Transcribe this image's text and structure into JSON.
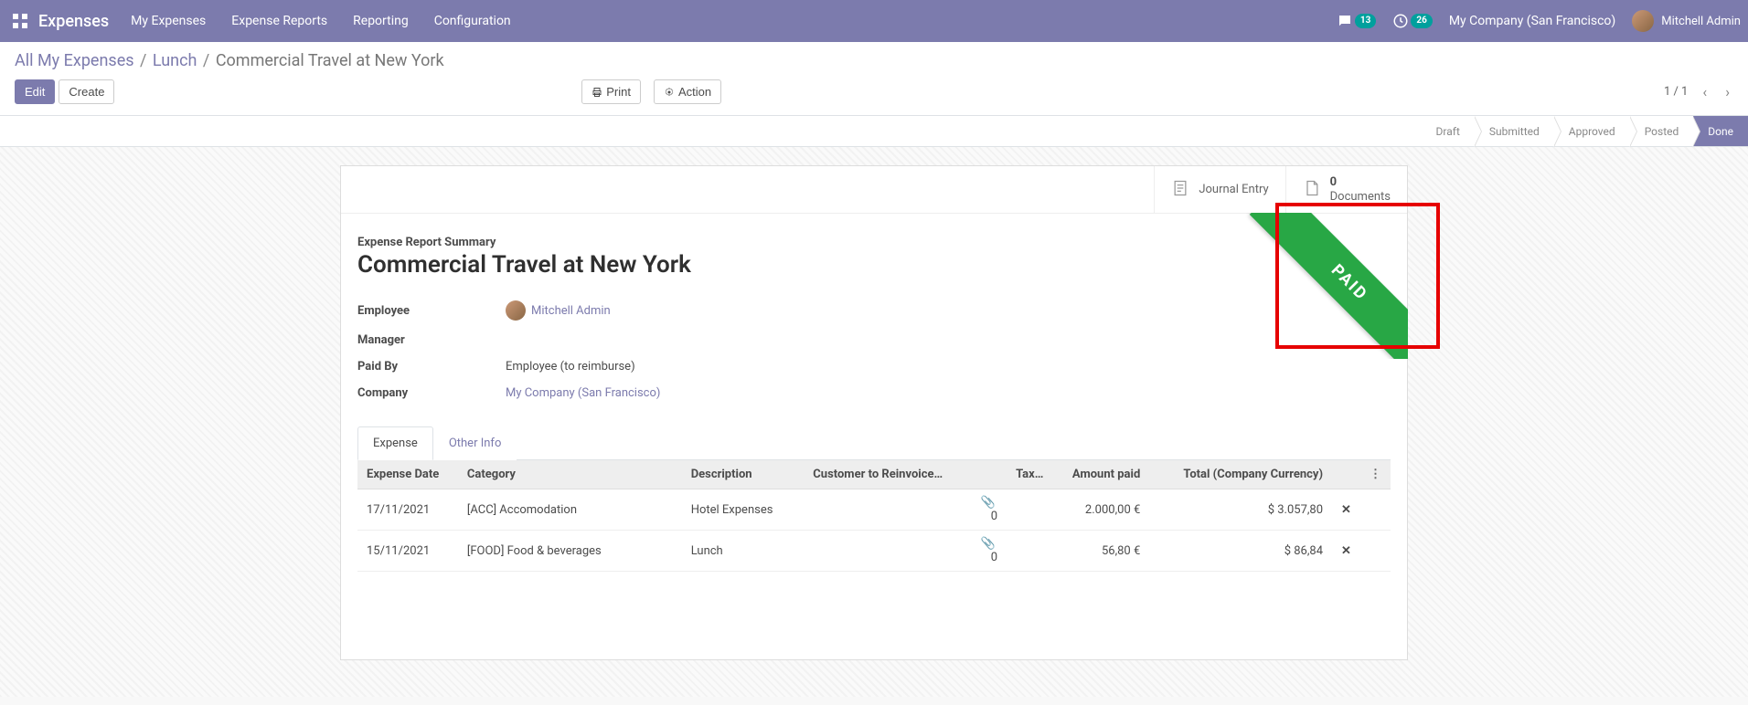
{
  "nav": {
    "brand": "Expenses",
    "menu": [
      "My Expenses",
      "Expense Reports",
      "Reporting",
      "Configuration"
    ],
    "chat_badge": "13",
    "activity_badge": "26",
    "company": "My Company (San Francisco)",
    "user": "Mitchell Admin"
  },
  "breadcrumb": {
    "parts": [
      "All My Expenses",
      "Lunch"
    ],
    "current": "Commercial Travel at New York"
  },
  "buttons": {
    "edit": "Edit",
    "create": "Create",
    "print": "Print",
    "action": "Action"
  },
  "pager": {
    "text": "1 / 1"
  },
  "status": {
    "steps": [
      "Draft",
      "Submitted",
      "Approved",
      "Posted",
      "Done"
    ],
    "active": "Done"
  },
  "stat_buttons": {
    "journal": "Journal Entry",
    "documents_count": "0",
    "documents_label": "Documents"
  },
  "ribbon": "PAID",
  "form": {
    "subtitle": "Expense Report Summary",
    "title": "Commercial Travel at New York",
    "labels": {
      "employee": "Employee",
      "manager": "Manager",
      "paid_by": "Paid By",
      "company": "Company"
    },
    "values": {
      "employee": "Mitchell Admin",
      "manager": "",
      "paid_by": "Employee (to reimburse)",
      "company": "My Company (San Francisco)"
    }
  },
  "tabs": {
    "expense": "Expense",
    "other": "Other Info"
  },
  "table": {
    "headers": {
      "date": "Expense Date",
      "category": "Category",
      "description": "Description",
      "customer": "Customer to Reinvoice…",
      "tax": "Tax…",
      "amount_paid": "Amount paid",
      "total": "Total (Company Currency)"
    },
    "rows": [
      {
        "date": "17/11/2021",
        "category": "[ACC] Accomodation",
        "description": "Hotel Expenses",
        "attach": "0",
        "amount": "2.000,00 €",
        "total": "$ 3.057,80"
      },
      {
        "date": "15/11/2021",
        "category": "[FOOD] Food & beverages",
        "description": "Lunch",
        "attach": "0",
        "amount": "56,80 €",
        "total": "$ 86,84"
      }
    ]
  }
}
